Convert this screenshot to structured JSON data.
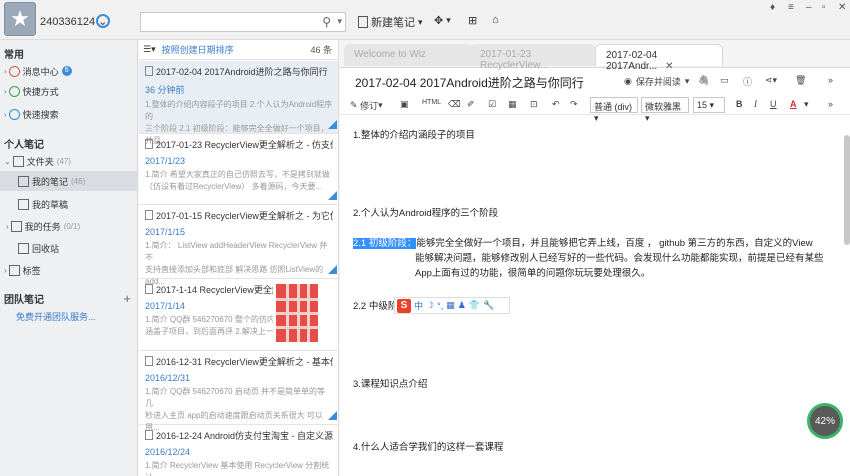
{
  "topbar": {
    "user_id": "240336124",
    "search_placeholder": "",
    "new_note_label": "新建笔记"
  },
  "window_controls": {
    "pin": "♦",
    "menu": "≡",
    "minimize": "–",
    "restore": "▫",
    "close": "✕"
  },
  "nav": {
    "section_common": "常用",
    "message_center": "消息中心",
    "message_badge": "6",
    "shortcuts": "快捷方式",
    "quick_search": "快速搜索",
    "section_personal": "个人笔记",
    "folders": "文件夹",
    "folders_count": "(47)",
    "my_notes": "我的笔记",
    "my_notes_count": "(46)",
    "my_drafts": "我的草稿",
    "my_tasks": "我的任务",
    "my_tasks_count": "(0/1)",
    "recycle_bin": "回收站",
    "tags": "标签",
    "section_team": "团队笔记",
    "team_link": "免费开通团队服务..."
  },
  "list": {
    "sort_label": "按照创建日期排序",
    "count": "46 条",
    "items": [
      {
        "title": "2017-02-04 2017Android进阶之路与你同行",
        "date": "36 分钟前",
        "snippet1": "1.整体的介绍内容段子的项目 2.个人认为Android程序的",
        "snippet2": "三个阶段 2.1 初级阶段：能够完全全做好一个项目，并且"
      },
      {
        "title": "2017-01-23 RecyclerView更全解析之 - 仿支付宝...",
        "date": "2017/1/23",
        "snippet1": "1.简介    希望大家真正的自己仿照去写，不是拷到就做",
        "snippet2": "（仿设有着过RecyclerView）    多着源码，今天要..."
      },
      {
        "title": "2017-01-15 RecyclerView更全解析之 - 为它优雅...",
        "date": "2017/1/15",
        "snippet1": "1.简介： ListView addHeaderView RecyclerView 并不",
        "snippet2": "支持直接添加头部和底部 解决思路 仿照ListView的add..."
      },
      {
        "title": "2017-1-14 RecyclerView更全解...",
        "date": "2017/1/14",
        "snippet1": "1.简介 QQ群 546270670 整个的仿内",
        "snippet2": "涵盖子项目，到后面再评 2.解决上一..."
      },
      {
        "title": "2016-12-31 RecyclerView更全解析之 - 基本使用...",
        "date": "2016/12/31",
        "snippet1": "1.简介 QQ群 546270670 启动页 并不是简单单的等几",
        "snippet2": "秒进入主页 app的启动速度跟启动页关系很大 可以用..."
      },
      {
        "title": "2016-12-24 Android仿支付宝淘宝 - 自定义源码...",
        "date": "2016/12/24",
        "snippet1": "1.简介 RecyclerView 基本使用 RecyclerView 分割统计",
        "snippet2": ""
      }
    ]
  },
  "editor": {
    "tabs": [
      {
        "label": "Welcome to Wiz"
      },
      {
        "label": "2017-01-23 RecyclerView..."
      },
      {
        "label": "2017-02-04 2017Andr..."
      }
    ],
    "title": "2017-02-04 2017Android进阶之路与你同行",
    "save_and_read": "保存并阅读",
    "edit_label": "修订",
    "para_style": "普通 (div)",
    "font_name": "微软雅黑",
    "font_size": "15",
    "p1": "1.整体的介绍内涵段子的项目",
    "p2": "2.个人认为Android程序的三个阶段",
    "p3_highlight": "2.1 初级阶段：",
    "p3_rest": "能够完全全做好一个项目，并且能够把它弄上线，百度 ， github 第三方的东西，自定义的View",
    "p3_line2": "能够解决问题，能够修改别人已经写好的一些代码。会发现什么功能都能实现，前提是已经有某些",
    "p3_line3": "App上面有过的功能，很简单的问题你玩玩要处理很久。",
    "p4": "2.2 中级阶段：",
    "p5": "3.课程知识点介绍",
    "p6": "4.什么人适合学我们的这样一套课程"
  },
  "ime": {
    "lang": "中",
    "moon": "☽",
    "punct": "°,",
    "kb": "▦",
    "skin": "♟",
    "shirt": "👕",
    "tool": "🔧"
  },
  "progress_percent": "42%"
}
